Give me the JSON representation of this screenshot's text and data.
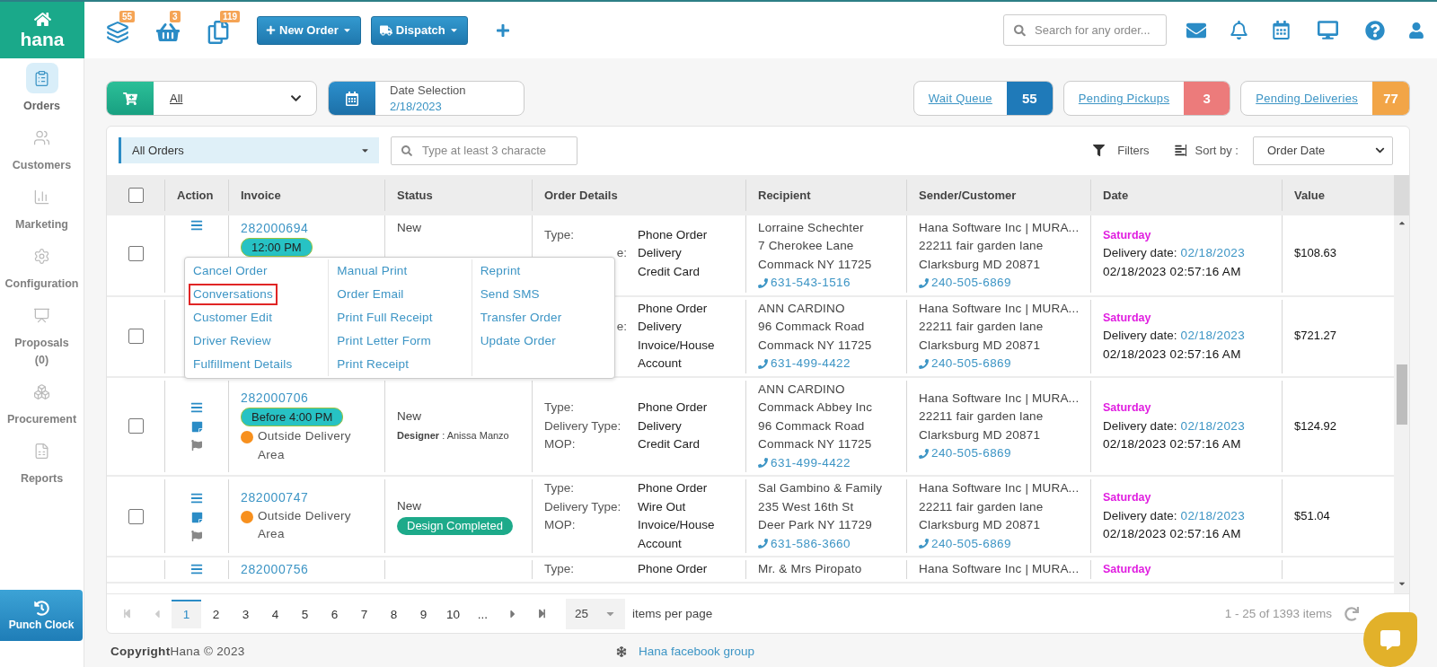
{
  "brand": {
    "name": "hana"
  },
  "sidebar": {
    "items": [
      {
        "kind": "orders",
        "label": "Orders",
        "selected": true
      },
      {
        "kind": "customers",
        "label": "Customers",
        "selected": false
      },
      {
        "kind": "marketing",
        "label": "Marketing",
        "selected": false
      },
      {
        "kind": "configuration",
        "label": "Configuration",
        "selected": false
      },
      {
        "kind": "proposals",
        "label": "Proposals",
        "count": "(0)",
        "selected": false
      },
      {
        "kind": "procurement",
        "label": "Procurement",
        "selected": false
      },
      {
        "kind": "reports",
        "label": "Reports",
        "selected": false
      }
    ],
    "punch_clock": "Punch Clock"
  },
  "topbar": {
    "counters": [
      {
        "kind": "stack",
        "badge": "55"
      },
      {
        "kind": "basket",
        "badge": "3"
      },
      {
        "kind": "copies",
        "badge": "119"
      }
    ],
    "buttons": [
      {
        "kind": "new",
        "label": "New Order"
      },
      {
        "kind": "dispatch",
        "label": "Dispatch"
      }
    ],
    "search": {
      "placeholder": "Search for any order..."
    }
  },
  "filters": {
    "order_type": {
      "value": "All"
    },
    "date": {
      "label": "Date Selection",
      "value": "2/18/2023"
    },
    "queues": [
      {
        "label": "Wait Queue",
        "count": "55",
        "color": "#1f7ab9"
      },
      {
        "label": "Pending Pickups",
        "count": "3",
        "color": "#ec7b7b"
      },
      {
        "label": "Pending Deliveries",
        "count": "77",
        "color": "#f2a547"
      }
    ]
  },
  "orders": {
    "view": {
      "value": "All Orders"
    },
    "search": {
      "placeholder": "Type at least 3 characte"
    },
    "filters_label": "Filters",
    "sort": {
      "label": "Sort by :",
      "value": "Order Date"
    },
    "table": {
      "header_checkbox": {
        "checked": false
      },
      "columns": [
        "Action",
        "Invoice",
        "Status",
        "Order Details",
        "Recipient",
        "Sender/Customer",
        "Date",
        "Value"
      ],
      "rows": [
        {
          "checked": false,
          "actions": [
            {
              "kind": "menu"
            }
          ],
          "invoice": {
            "number": "282000694",
            "badge": "12:00 PM"
          },
          "status": {
            "text": "New"
          },
          "details": [
            {
              "label": "Type:",
              "value": "Phone Order"
            },
            {
              "label": "e:",
              "clipped": true,
              "value": "Delivery"
            },
            {
              "value": "Credit Card"
            }
          ],
          "recipient": {
            "lines": [
              "Lorraine Schechter",
              "7 Cherokee Lane",
              "Commack NY 11725"
            ],
            "phone": "631-543-1516"
          },
          "sender": {
            "lines": [
              "Hana Software Inc | MURA...",
              "22211 fair garden lane",
              "Clarksburg MD 20871"
            ],
            "phone": "240-505-6869"
          },
          "date": {
            "day": "Saturday",
            "delivery_label": "Delivery date:",
            "delivery_date": "02/18/2023",
            "created": "02/18/2023 02:57:16 AM"
          },
          "value": "$108.63"
        },
        {
          "checked": false,
          "actions": [],
          "details": [
            {
              "value": "Phone Order"
            },
            {
              "label": "e:",
              "clipped": true,
              "value": "Delivery"
            },
            {
              "value": "Invoice/House Account"
            }
          ],
          "recipient": {
            "lines": [
              "ANN CARDINO",
              "96 Commack Road",
              "Commack NY 11725"
            ],
            "phone": "631-499-4422"
          },
          "sender": {
            "lines": [
              "Hana Software Inc | MURA...",
              "22211 fair garden lane",
              "Clarksburg MD 20871"
            ],
            "phone": "240-505-6869"
          },
          "date": {
            "day": "Saturday",
            "delivery_label": "Delivery date:",
            "delivery_date": "02/18/2023",
            "created": "02/18/2023 02:57:16 AM"
          },
          "value": "$721.27"
        },
        {
          "checked": false,
          "actions": [
            {
              "kind": "menu"
            },
            {
              "kind": "note"
            },
            {
              "kind": "flag"
            }
          ],
          "invoice": {
            "number": "282000706",
            "badge": "Before 4:00 PM",
            "alert": "Outside Delivery Area"
          },
          "status": {
            "text": "New",
            "designer": "**Designer** : Anissa Manzo"
          },
          "details": [
            {
              "label": "Type:",
              "value": "Phone Order"
            },
            {
              "label": "Delivery Type:",
              "value": "Delivery"
            },
            {
              "label": "MOP:",
              "value": "Credit Card"
            }
          ],
          "recipient": {
            "lines": [
              "ANN CARDINO",
              "Commack Abbey Inc",
              "96 Commack Road",
              "Commack NY 11725"
            ],
            "phone": "631-499-4422"
          },
          "sender": {
            "lines": [
              "Hana Software Inc | MURA...",
              "22211 fair garden lane",
              "Clarksburg MD 20871"
            ],
            "phone": "240-505-6869"
          },
          "date": {
            "day": "Saturday",
            "delivery_label": "Delivery date:",
            "delivery_date": "02/18/2023",
            "created": "02/18/2023 02:57:16 AM"
          },
          "value": "$124.92"
        },
        {
          "checked": false,
          "actions": [
            {
              "kind": "menu"
            },
            {
              "kind": "note"
            },
            {
              "kind": "flag"
            }
          ],
          "invoice": {
            "number": "282000747",
            "alert": "Outside Delivery Area"
          },
          "status": {
            "text": "New",
            "badge": "Design Completed"
          },
          "details": [
            {
              "label": "Type:",
              "value": "Phone Order"
            },
            {
              "label": "Delivery Type:",
              "value": "Wire Out"
            },
            {
              "label": "MOP:",
              "value": "Invoice/House Account"
            }
          ],
          "recipient": {
            "lines": [
              "Sal Gambino & Family",
              "235 West 16th St",
              "Deer Park NY 11729"
            ],
            "phone": "631-586-3660"
          },
          "sender": {
            "lines": [
              "Hana Software Inc | MURA...",
              "22211 fair garden lane",
              "Clarksburg MD 20871"
            ],
            "phone": "240-505-6869"
          },
          "date": {
            "day": "Saturday",
            "delivery_label": "Delivery date:",
            "delivery_date": "02/18/2023",
            "created": "02/18/2023 02:57:16 AM"
          },
          "value": "$51.04"
        },
        {
          "actions": [
            {
              "kind": "menu"
            }
          ],
          "invoice": {
            "number": "282000756"
          },
          "details": [
            {
              "label": "Type:",
              "value": "Phone Order"
            }
          ],
          "recipient": {
            "lines": [
              "Mr. & Mrs Piropato"
            ]
          },
          "sender": {
            "lines": [
              "Hana Software Inc | MURA..."
            ]
          },
          "date": {
            "day": "Saturday"
          }
        }
      ]
    },
    "action_menu": {
      "columns": [
        [
          {
            "label": "Cancel Order",
            "selected": false
          },
          {
            "label": "Conversations",
            "selected": true
          },
          {
            "label": "Customer Edit",
            "selected": false
          },
          {
            "label": "Driver Review",
            "selected": false
          },
          {
            "label": "Fulfillment Details",
            "selected": false
          }
        ],
        [
          {
            "label": "Manual Print",
            "selected": false
          },
          {
            "label": "Order Email",
            "selected": false
          },
          {
            "label": "Print Full Receipt",
            "selected": false
          },
          {
            "label": "Print Letter Form",
            "selected": false
          },
          {
            "label": "Print Receipt",
            "selected": false
          }
        ],
        [
          {
            "label": "Reprint",
            "selected": false
          },
          {
            "label": "Send SMS",
            "selected": false
          },
          {
            "label": "Transfer Order",
            "selected": false
          },
          {
            "label": "Update Order",
            "selected": false
          }
        ]
      ]
    },
    "pagination": {
      "nav_start": [
        {
          "kind": "first",
          "disabled": true
        },
        {
          "kind": "prev",
          "disabled": true
        }
      ],
      "pages": [
        {
          "label": "1",
          "selected": true
        },
        {
          "label": "2",
          "selected": false
        },
        {
          "label": "3",
          "selected": false
        },
        {
          "label": "4",
          "selected": false
        },
        {
          "label": "5",
          "selected": false
        },
        {
          "label": "6",
          "selected": false
        },
        {
          "label": "7",
          "selected": false
        },
        {
          "label": "8",
          "selected": false
        },
        {
          "label": "9",
          "selected": false
        },
        {
          "label": "10",
          "selected": false
        },
        {
          "label": "...",
          "selected": false
        }
      ],
      "nav_end": [
        {
          "kind": "next",
          "disabled": false
        },
        {
          "kind": "last",
          "disabled": false
        }
      ],
      "page_size": "25",
      "page_size_label": "items per page",
      "summary": "1 - 25 of 1393 items"
    }
  },
  "footer": {
    "copyright": "**Copyright**Hana © 2023",
    "link": "Hana facebook group"
  }
}
